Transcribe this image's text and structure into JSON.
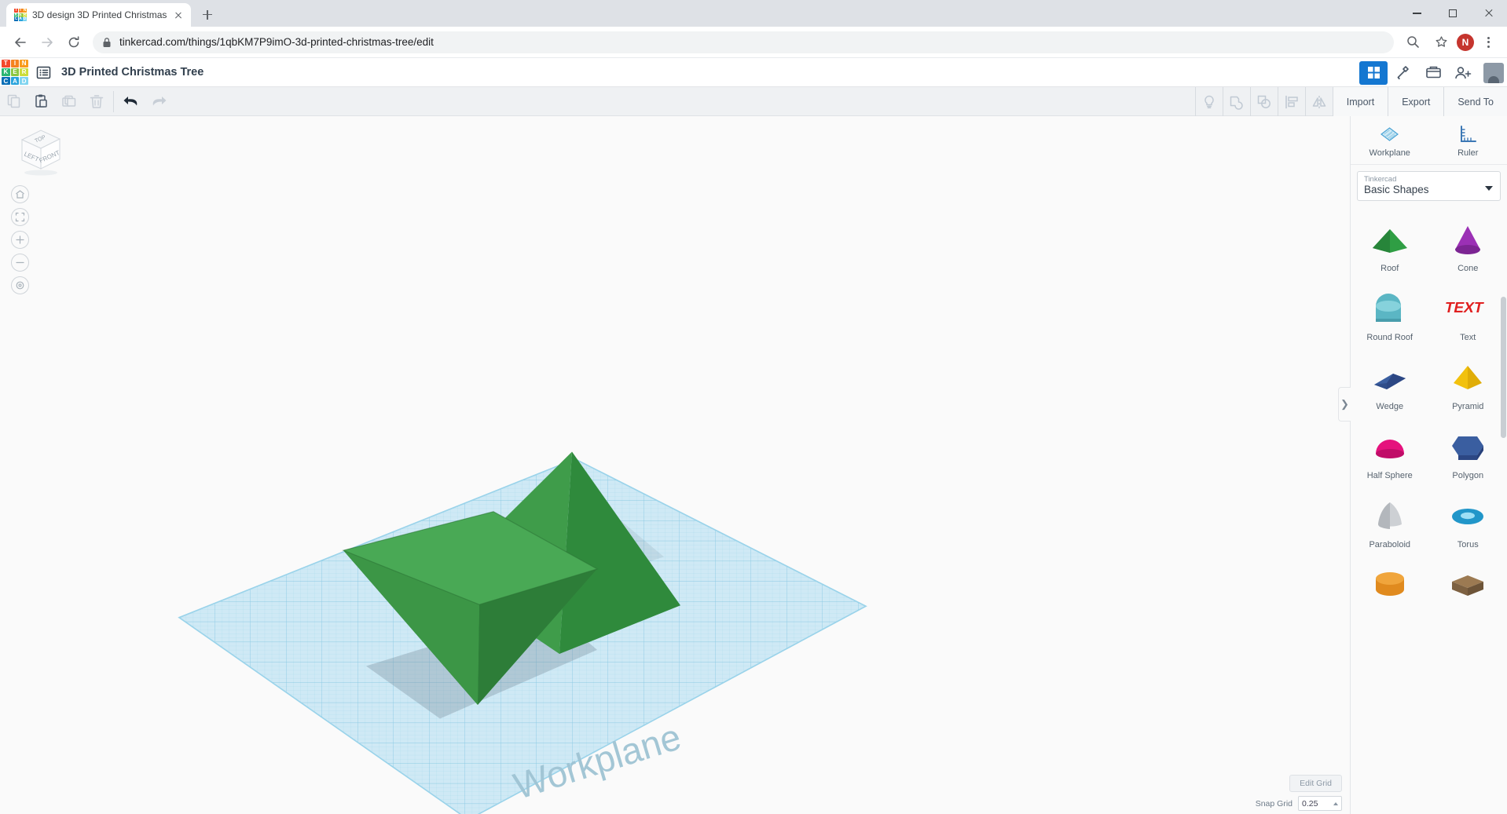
{
  "browser": {
    "tab": {
      "title": "3D design 3D Printed Christmas",
      "favicon": "tinkercad-logo-icon"
    },
    "newtab_tooltip": "New Tab",
    "url": "tinkercad.com/things/1qbKM7P9imO-3d-printed-christmas-tree/edit",
    "avatar_initial": "N",
    "window_controls": [
      "minimize",
      "maximize",
      "close"
    ]
  },
  "app_header": {
    "logo_letters": [
      "T",
      "I",
      "N",
      "K",
      "E",
      "R",
      "C",
      "A",
      "D"
    ],
    "logo_colors": [
      "#f4482c",
      "#f58220",
      "#f99b1c",
      "#2bb673",
      "#8cc63f",
      "#cddc39",
      "#0a6fb7",
      "#29a3dc",
      "#7fd4f0"
    ],
    "project_title": "3D Printed Christmas Tree",
    "buttons": [
      "grid-view-button",
      "tools-button",
      "gallery-button",
      "invite-button",
      "account-avatar"
    ]
  },
  "toolbar": {
    "left_tools": [
      "copy",
      "paste",
      "duplicate",
      "delete",
      "undo",
      "redo"
    ],
    "right_icons": [
      "lightbulb-icon",
      "group-icon",
      "ungroup-icon",
      "align-icon",
      "mirror-icon"
    ],
    "import_label": "Import",
    "export_label": "Export",
    "sendto_label": "Send To"
  },
  "viewport": {
    "viewcube_faces": {
      "top": "TOP",
      "left": "LEFT",
      "front": "FRONT"
    },
    "nav_buttons": [
      "home-view-icon",
      "fit-to-view-icon",
      "zoom-in-icon",
      "zoom-out-icon",
      "orthographic-icon"
    ],
    "workplane_label": "Workplane",
    "edit_grid_label": "Edit Grid",
    "snap_grid_label": "Snap Grid",
    "snap_grid_value": "0.25",
    "objects": [
      {
        "name": "inverted-pyramid",
        "color": "#3f9c4a"
      },
      {
        "name": "pyramid",
        "color": "#3f9c4a"
      }
    ],
    "workplane_color": "#bfe3f2"
  },
  "shapes_panel": {
    "tools": [
      {
        "label": "Workplane",
        "icon": "workplane-icon"
      },
      {
        "label": "Ruler",
        "icon": "ruler-icon"
      }
    ],
    "dropdown_label": "Tinkercad",
    "dropdown_value": "Basic Shapes",
    "collapse_icon": "chevron-right-icon",
    "shapes": [
      {
        "label": "Roof",
        "color": "#2f9e44",
        "icon": "roof-shape"
      },
      {
        "label": "Cone",
        "color": "#9b30b5",
        "icon": "cone-shape"
      },
      {
        "label": "Round Roof",
        "color": "#5bb6c4",
        "icon": "round-roof-shape"
      },
      {
        "label": "Text",
        "color": "#e02020",
        "icon": "text-shape"
      },
      {
        "label": "Wedge",
        "color": "#2f4d8a",
        "icon": "wedge-shape"
      },
      {
        "label": "Pyramid",
        "color": "#f2c10e",
        "icon": "pyramid-shape"
      },
      {
        "label": "Half Sphere",
        "color": "#e5127d",
        "icon": "half-sphere-shape"
      },
      {
        "label": "Polygon",
        "color": "#2f4d8a",
        "icon": "polygon-shape"
      },
      {
        "label": "Paraboloid",
        "color": "#b9bcc0",
        "icon": "paraboloid-shape"
      },
      {
        "label": "Torus",
        "color": "#2196c9",
        "icon": "torus-shape"
      },
      {
        "label": "",
        "color": "#e08a1e",
        "icon": "tube-shape"
      },
      {
        "label": "",
        "color": "#8a6a45",
        "icon": "box-shape"
      }
    ]
  }
}
